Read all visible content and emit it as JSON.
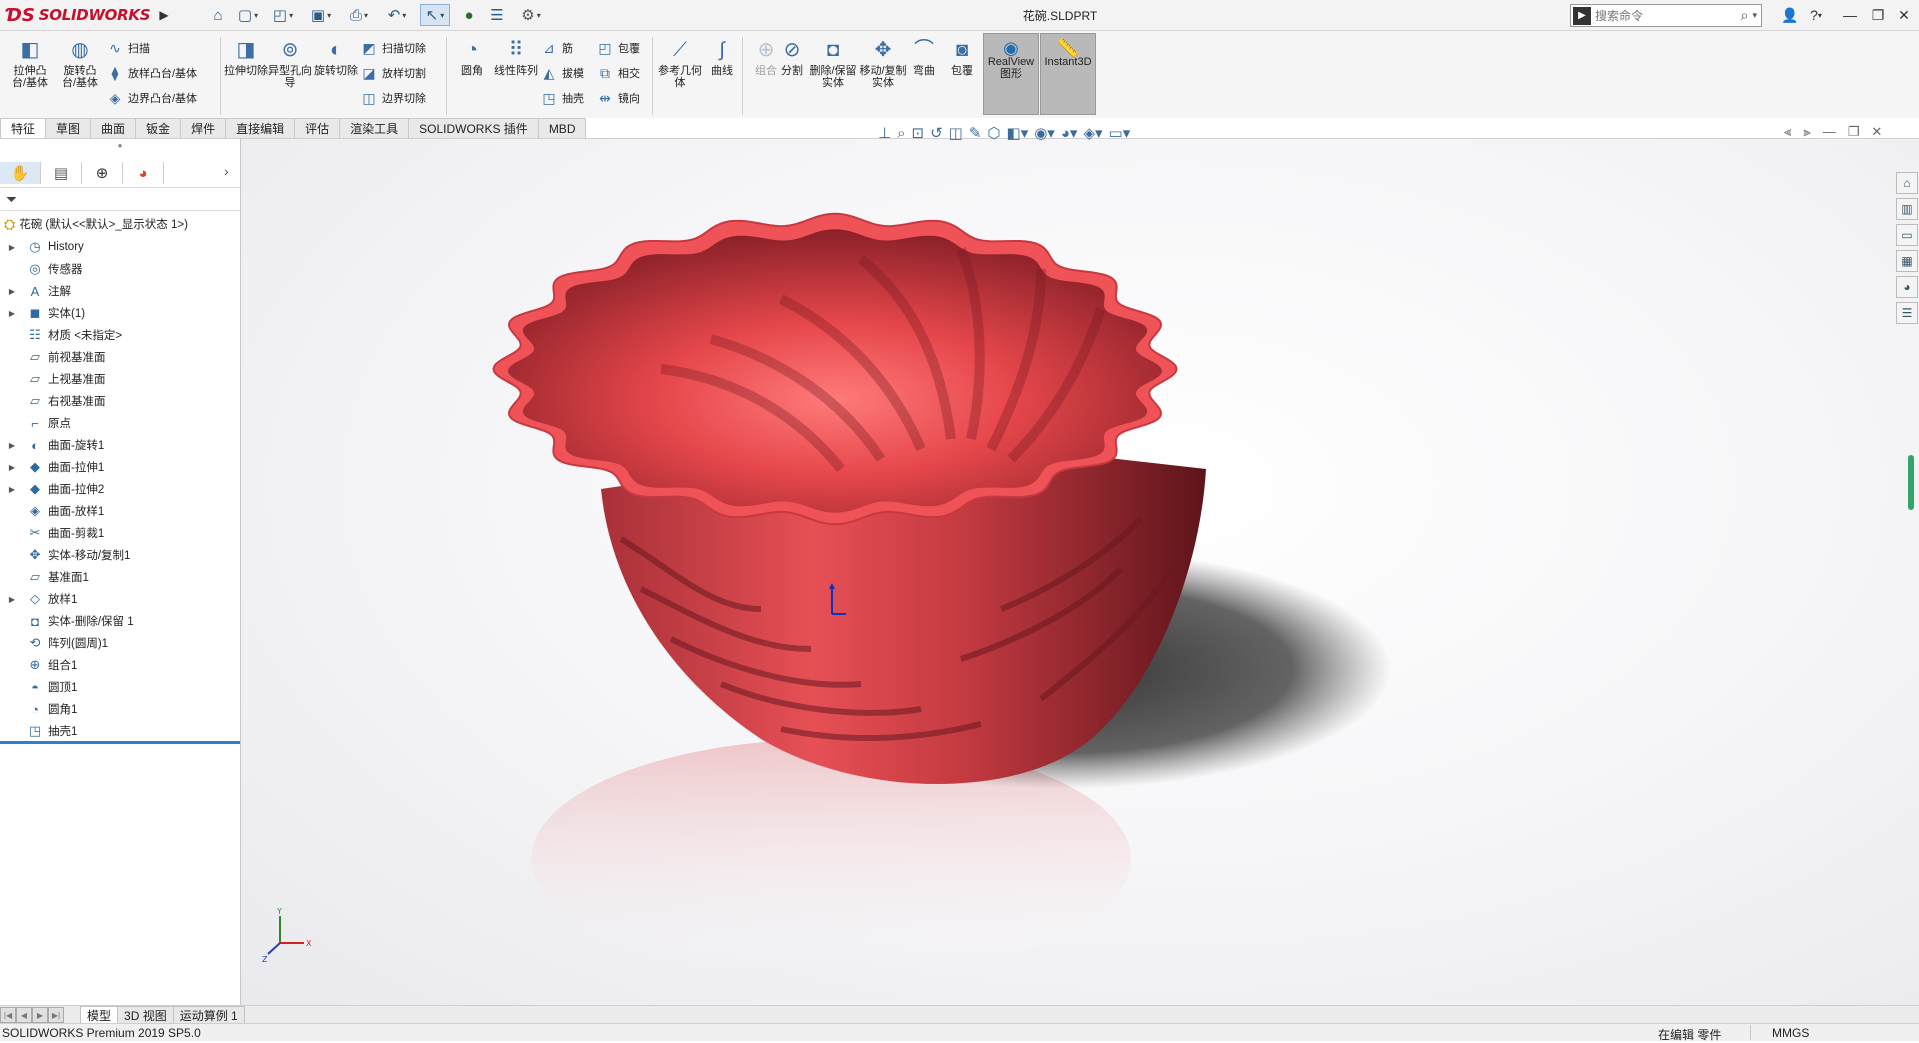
{
  "app": {
    "logo_text": "SOLIDWORKS",
    "document_title": "花碗.SLDPRT",
    "search_placeholder": "搜索命令"
  },
  "command_manager": {
    "extrude_boss": "拉伸凸台/基体",
    "revolve_boss": "旋转凸台/基体",
    "sweep": "扫描",
    "loft_boss": "放样凸台/基体",
    "boundary_boss": "边界凸台/基体",
    "extrude_cut": "拉伸切除",
    "hole_wizard": "异型孔向导",
    "revolve_cut": "旋转切除",
    "swept_cut": "扫描切除",
    "lofted_cut": "放样切割",
    "boundary_cut": "边界切除",
    "fillet": "圆角",
    "linear_pattern": "线性阵列",
    "rib": "筋",
    "draft": "拔模",
    "shell": "抽壳",
    "wrap": "包覆",
    "intersect": "相交",
    "mirror": "镜向",
    "ref_geometry": "参考几何体",
    "curves": "曲线",
    "combine": "组合",
    "split": "分割",
    "delete_keep_body": "删除/保留实体",
    "move_copy_body": "移动/复制实体",
    "flex": "弯曲",
    "wrap2": "包覆",
    "realview": "RealView图形",
    "instant3d": "Instant3D"
  },
  "tabs": [
    "特征",
    "草图",
    "曲面",
    "钣金",
    "焊件",
    "直接编辑",
    "评估",
    "渲染工具",
    "SOLIDWORKS 插件",
    "MBD"
  ],
  "tree": {
    "root": "花碗 (默认<<默认>_显示状态 1>)",
    "items": [
      {
        "label": "History",
        "expandable": true,
        "icon": "history-icon"
      },
      {
        "label": "传感器",
        "expandable": false,
        "icon": "sensor-icon"
      },
      {
        "label": "注解",
        "expandable": true,
        "icon": "annotation-icon"
      },
      {
        "label": "实体(1)",
        "expandable": true,
        "icon": "solid-bodies-icon"
      },
      {
        "label": "材质 <未指定>",
        "expandable": false,
        "icon": "material-icon"
      },
      {
        "label": "前视基准面",
        "expandable": false,
        "icon": "plane-icon"
      },
      {
        "label": "上视基准面",
        "expandable": false,
        "icon": "plane-icon"
      },
      {
        "label": "右视基准面",
        "expandable": false,
        "icon": "plane-icon"
      },
      {
        "label": "原点",
        "expandable": false,
        "icon": "origin-icon"
      },
      {
        "label": "曲面-旋转1",
        "expandable": true,
        "icon": "surface-revolve-icon"
      },
      {
        "label": "曲面-拉伸1",
        "expandable": true,
        "icon": "surface-extrude-icon"
      },
      {
        "label": "曲面-拉伸2",
        "expandable": true,
        "icon": "surface-extrude-icon"
      },
      {
        "label": "曲面-放样1",
        "expandable": false,
        "icon": "surface-loft-icon"
      },
      {
        "label": "曲面-剪裁1",
        "expandable": false,
        "icon": "surface-trim-icon"
      },
      {
        "label": "实体-移动/复制1",
        "expandable": false,
        "icon": "move-copy-icon"
      },
      {
        "label": "基准面1",
        "expandable": false,
        "icon": "plane-icon"
      },
      {
        "label": "放样1",
        "expandable": true,
        "icon": "loft-icon"
      },
      {
        "label": "实体-删除/保留 1",
        "expandable": false,
        "icon": "delete-keep-icon"
      },
      {
        "label": "阵列(圆周)1",
        "expandable": false,
        "icon": "circular-pattern-icon"
      },
      {
        "label": "组合1",
        "expandable": false,
        "icon": "combine-icon"
      },
      {
        "label": "圆顶1",
        "expandable": false,
        "icon": "dome-icon"
      },
      {
        "label": "圆角1",
        "expandable": false,
        "icon": "fillet-icon"
      },
      {
        "label": "抽壳1",
        "expandable": false,
        "icon": "shell-icon"
      }
    ]
  },
  "bottom_tabs": [
    "模型",
    "3D 视图",
    "运动算例 1"
  ],
  "status": {
    "product": "SOLIDWORKS Premium 2019 SP5.0",
    "editing": "在编辑 零件",
    "units": "MMGS"
  },
  "colors": {
    "bowl_main": "#e04a4e",
    "bowl_dark": "#7a1a22",
    "bowl_light": "#ff6d6d",
    "accent": "#c8102e",
    "rollback": "#2b7fd6"
  }
}
